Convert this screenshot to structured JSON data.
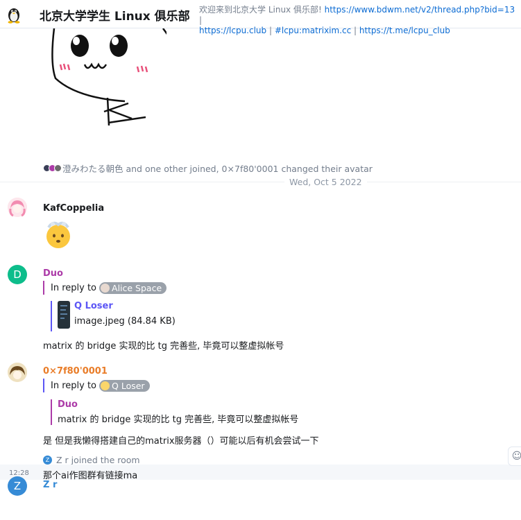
{
  "header": {
    "room_name": "北京大学学生 Linux 俱乐部",
    "chevron_icon": "chevron-down-icon",
    "topic_prefix": "欢迎来到北京大学 Linux 俱乐部! ",
    "topic_link_1": "https://www.bdwm.net/v2/thread.php?bid=13",
    "topic_sep_1": " | ",
    "topic_link_2": "https://lcpu.club",
    "topic_sep_2": " | ",
    "topic_link_3": "#lcpu:matrixim.cc",
    "topic_sep_3": " | ",
    "topic_link_4": "https://t.me/lcpu_club",
    "link_color": "#0b6bd3"
  },
  "timeline": {
    "membership_summary": "澄みわたる朝色 and one other joined, 0×7f80'0001 changed their avatar",
    "date_separator": "Wed, Oct 5 2022",
    "messages": [
      {
        "sender": "KafCoppelia",
        "sender_color": "#368bd6",
        "content_icon": "dizzy-face-emoji"
      },
      {
        "sender": "Duo",
        "avatar_letter": "D",
        "sender_color": "#ac3ba8",
        "reply_prefix": "In reply to",
        "reply_to": "Alice Space",
        "quote_sender": "Q Loser",
        "quote_attachment": "image.jpeg (84.84 KB)",
        "text": "matrix 的 bridge 实现的比 tg 完善些, 毕竟可以整虚拟帐号"
      },
      {
        "sender": "0×7f80'0001",
        "sender_color": "#e97d29",
        "reply_prefix": "In reply to",
        "reply_to": "Q Loser",
        "quote_sender": "Duo",
        "quote_text": "matrix 的 bridge 实现的比 tg 完善些, 毕竟可以整虚拟帐号",
        "text": "是 但是我懒得搭建自己的matrix服务器（）可能以后有机会尝试一下"
      }
    ],
    "member_event": {
      "avatar_letter": "Z",
      "text": "Z r joined the room"
    },
    "last_message": {
      "sender": "Z r",
      "avatar_letter": "Z",
      "sender_color": "#368bd6",
      "timestamp": "12:28",
      "text": "那个ai作图群有链接ma",
      "react_icon": "react-smiley-icon"
    }
  }
}
